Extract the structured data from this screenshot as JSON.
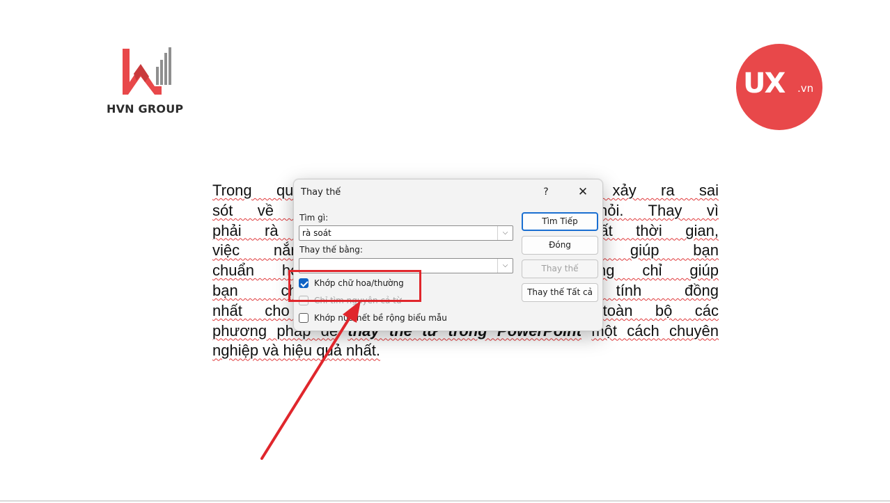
{
  "logos": {
    "left_text": "HVN GROUP",
    "right_main": "UX",
    "right_suffix": ".vn",
    "right_color": "#e8484a",
    "left_color": "#e8484a"
  },
  "document": {
    "line1_a": "Trong quá",
    "line1_b": ", việc xảy ra sai",
    "line2_a": "sót về thuậ",
    "line2_b": "h khỏi. Thay vì",
    "line3_a": "phải rà soá",
    "line3_b": "y mất thời gian,",
    "line4_a": "việc nắm",
    "line4_b": "nt sẽ giúp bạn",
    "line5_a": "chuẩn hóa",
    "line5_b": "y không chỉ giúp",
    "line6_a": "bạn chỉnh",
    "line6_b": "bảo tính đồng",
    "line7_a": "nhất cho to",
    "line7_b": "bạn toàn bộ các",
    "line8_a": "phương pháp để",
    "line8_bi": "thay thế từ trong PowerPoint",
    "line8_b": "một cách chuyên",
    "line9": "nghiệp và hiệu quả nhất."
  },
  "dialog": {
    "title": "Thay thế",
    "help": "?",
    "close": "✕",
    "find_label": "Tìm gì:",
    "find_value": "rà soát",
    "replace_label": "Thay thế bằng:",
    "replace_value": "",
    "dropdown_arrow": "⌵",
    "options": [
      {
        "label": "Khớp chữ hoa/thường",
        "checked": true,
        "disabled": false
      },
      {
        "label": "Chỉ tìm nguyên cả từ",
        "checked": false,
        "disabled": true
      },
      {
        "label": "Khớp nửa/hết bề rộng biểu mẫu",
        "checked": false,
        "disabled": false
      }
    ],
    "buttons": {
      "find_next": "Tìm Tiếp",
      "close": "Đóng",
      "replace": "Thay thế",
      "replace_all": "Thay thế Tất cả"
    }
  },
  "annotation": {
    "color": "#e0262c"
  }
}
